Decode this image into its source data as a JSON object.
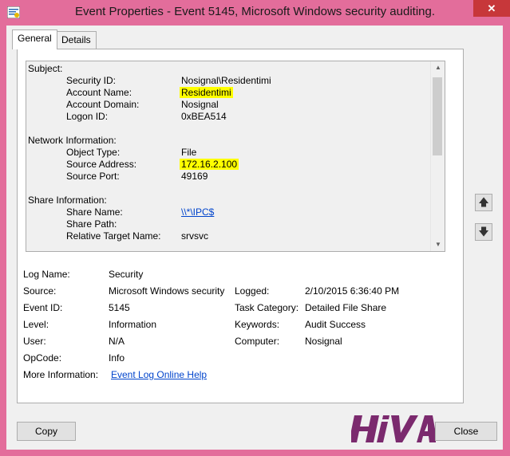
{
  "window": {
    "title": "Event Properties - Event 5145, Microsoft Windows security auditing.",
    "close_icon": "close-icon",
    "app_icon": "event-viewer-icon"
  },
  "tabs": [
    {
      "label": "General",
      "selected": true
    },
    {
      "label": "Details",
      "selected": false
    }
  ],
  "description": {
    "subject_heading": "Subject:",
    "subject": [
      {
        "label": "Security ID:",
        "value": "Nosignal\\Residentimi"
      },
      {
        "label": "Account Name:",
        "value": "Residentimi"
      },
      {
        "label": "Account Domain:",
        "value": "Nosignal"
      },
      {
        "label": "Logon ID:",
        "value": "0xBEA514"
      }
    ],
    "network_heading": "Network Information:",
    "network": [
      {
        "label": "Object Type:",
        "value": "File"
      },
      {
        "label": "Source Address:",
        "value": "172.16.2.100"
      },
      {
        "label": "Source Port:",
        "value": "49169"
      }
    ],
    "share_heading": "Share Information:",
    "share": [
      {
        "label": "Share Name:",
        "value": "\\\\*\\IPC$"
      },
      {
        "label": "Share Path:",
        "value": ""
      },
      {
        "label": "Relative Target Name:",
        "value": "srvsvc"
      }
    ],
    "highlight_color": "#ffff00"
  },
  "info": {
    "log_name_label": "Log Name:",
    "log_name": "Security",
    "source_label": "Source:",
    "source": "Microsoft Windows security",
    "logged_label": "Logged:",
    "logged": "2/10/2015 6:36:40 PM",
    "event_id_label": "Event ID:",
    "event_id": "5145",
    "task_category_label": "Task Category:",
    "task_category": "Detailed File Share",
    "level_label": "Level:",
    "level": "Information",
    "keywords_label": "Keywords:",
    "keywords": "Audit Success",
    "user_label": "User:",
    "user": "N/A",
    "computer_label": "Computer:",
    "computer": "Nosignal",
    "opcode_label": "OpCode:",
    "opcode": "Info",
    "more_info_label": "More Information:",
    "more_info_link": "Event Log Online Help"
  },
  "buttons": {
    "copy": "Copy",
    "close": "Close",
    "up_icon": "arrow-up-icon",
    "down_icon": "arrow-down-icon"
  },
  "logo": {
    "text": "HIVA",
    "color": "#7b2a6e"
  },
  "colors": {
    "window_frame": "#e36d9b",
    "close_button": "#c7373a",
    "link": "#0044cc"
  }
}
